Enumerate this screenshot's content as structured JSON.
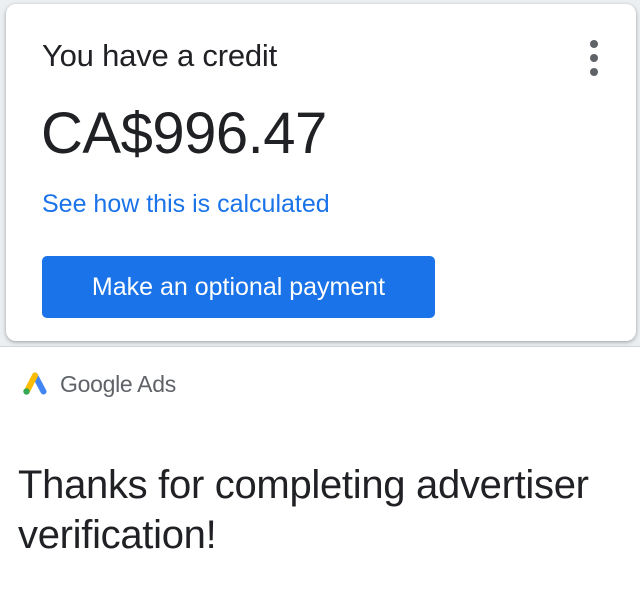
{
  "credit_card": {
    "title": "You have a credit",
    "amount": "CA$996.47",
    "calc_link": "See how this is calculated",
    "pay_button": "Make an optional payment",
    "menu_icon": "more-vert-icon"
  },
  "footer": {
    "logo_icon": "google-ads-logo-icon",
    "brand": "Google Ads",
    "message": "Thanks for completing advertiser verification!"
  },
  "colors": {
    "accent": "#1a73e8",
    "text_primary": "#202124",
    "text_secondary": "#5f6368",
    "logo_blue": "#4285f4",
    "logo_yellow": "#fbbc04",
    "logo_green": "#34a853"
  }
}
